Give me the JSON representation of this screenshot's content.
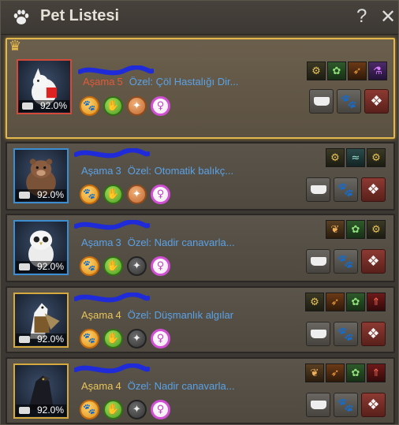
{
  "window": {
    "title": "Pet Listesi",
    "help_label": "?",
    "close_label": "✕"
  },
  "pets": [
    {
      "id": "pet-1",
      "selected": true,
      "stage_label": "Aşama",
      "stage": "5",
      "stage_color": "#e05a3a",
      "ozel_label": "Özel:",
      "ozel_text": "Çöl Hastalığı Dir...",
      "food_percent": "92.0%",
      "portrait_border": "#d34a3a",
      "skills": [
        "sk-orange",
        "sk-green",
        "sk-tan",
        "sk-pink"
      ],
      "buffs": [
        "b-dark",
        "b-green",
        "b-orange",
        "b-purple"
      ],
      "actions": [
        "feed-bowl-icon",
        "paw-icon",
        "gift-icon"
      ]
    },
    {
      "id": "pet-2",
      "selected": false,
      "stage_label": "Aşama",
      "stage": "3",
      "stage_color": "#5aa2e6",
      "ozel_label": "Özel:",
      "ozel_text": "Otomatik balıkç...",
      "food_percent": "92.0%",
      "portrait_border": "#3c8ed1",
      "skills": [
        "sk-orange",
        "sk-green",
        "sk-tan",
        "sk-pink"
      ],
      "buffs": [
        "b-dark",
        "b-teal",
        "b-dark"
      ],
      "actions": [
        "feed-bowl-icon",
        "paw-icon",
        "gift-icon"
      ]
    },
    {
      "id": "pet-3",
      "selected": false,
      "stage_label": "Aşama",
      "stage": "3",
      "stage_color": "#5aa2e6",
      "ozel_label": "Özel:",
      "ozel_text": "Nadir canavarla...",
      "food_percent": "92.0%",
      "portrait_border": "#3c8ed1",
      "skills": [
        "sk-orange",
        "sk-green",
        "sk-gray",
        "sk-pink"
      ],
      "buffs": [
        "b-brown",
        "b-green",
        "b-dark"
      ],
      "actions": [
        "feed-bowl-icon",
        "paw-icon",
        "gift-icon"
      ]
    },
    {
      "id": "pet-4",
      "selected": false,
      "stage_label": "Aşama",
      "stage": "4",
      "stage_color": "#e8c45a",
      "ozel_label": "Özel:",
      "ozel_text": "Düşmanlık algılar",
      "food_percent": "92.0%",
      "portrait_border": "#d6a93c",
      "skills": [
        "sk-orange",
        "sk-green",
        "sk-gray",
        "sk-pink"
      ],
      "buffs": [
        "b-dark",
        "b-orange",
        "b-green",
        "b-red"
      ],
      "actions": [
        "feed-bowl-icon",
        "paw-icon",
        "gift-icon"
      ]
    },
    {
      "id": "pet-5",
      "selected": false,
      "stage_label": "Aşama",
      "stage": "4",
      "stage_color": "#e8c45a",
      "ozel_label": "Özel:",
      "ozel_text": "Nadir canavarla...",
      "food_percent": "92.0%",
      "portrait_border": "#d6a93c",
      "skills": [
        "sk-orange",
        "sk-green",
        "sk-gray",
        "sk-pink"
      ],
      "buffs": [
        "b-brown",
        "b-orange",
        "b-green",
        "b-red"
      ],
      "actions": [
        "feed-bowl-icon",
        "paw-icon",
        "gift-icon"
      ]
    }
  ]
}
